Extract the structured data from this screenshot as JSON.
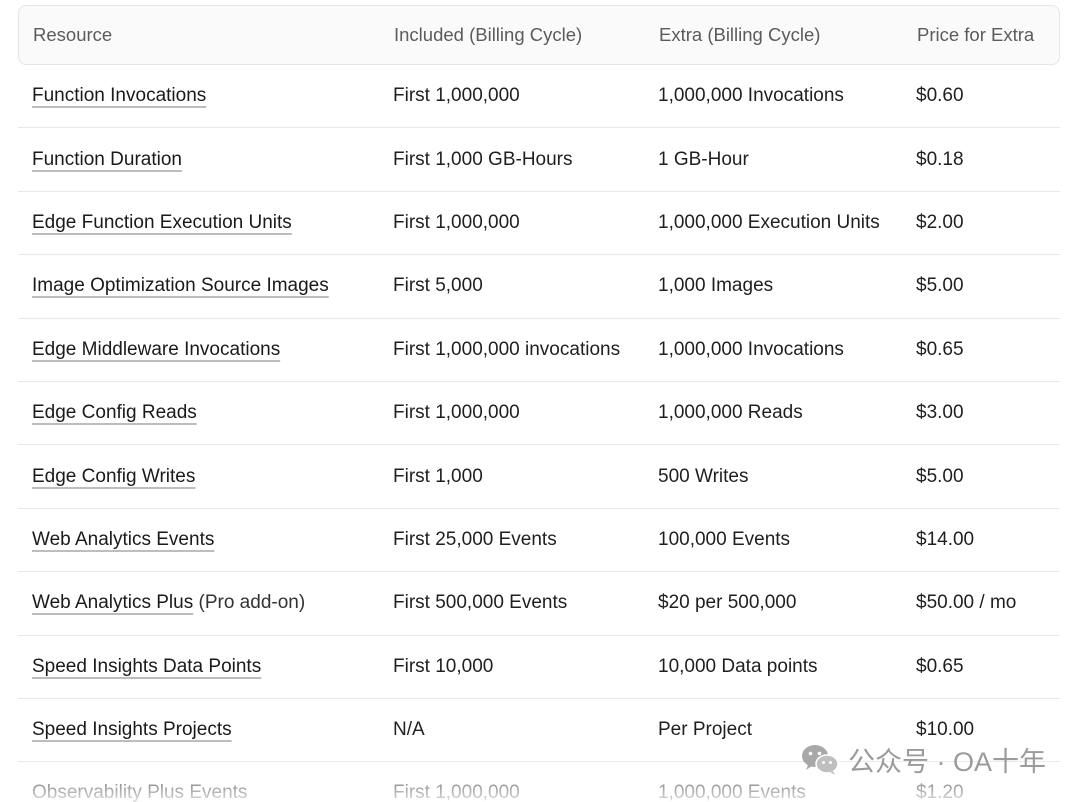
{
  "table": {
    "headers": [
      "Resource",
      "Included (Billing Cycle)",
      "Extra (Billing Cycle)",
      "Price for Extra"
    ],
    "rows": [
      {
        "resource": "Function Invocations",
        "suffix": "",
        "included": "First 1,000,000",
        "extra": "1,000,000 Invocations",
        "price": "$0.60"
      },
      {
        "resource": "Function Duration",
        "suffix": "",
        "included": "First 1,000 GB-Hours",
        "extra": "1 GB-Hour",
        "price": "$0.18"
      },
      {
        "resource": "Edge Function Execution Units",
        "suffix": "",
        "included": "First 1,000,000",
        "extra": "1,000,000 Execution Units",
        "price": "$2.00"
      },
      {
        "resource": "Image Optimization Source Images",
        "suffix": "",
        "included": "First 5,000",
        "extra": "1,000 Images",
        "price": "$5.00"
      },
      {
        "resource": "Edge Middleware Invocations",
        "suffix": "",
        "included": "First 1,000,000 invocations",
        "extra": "1,000,000 Invocations",
        "price": "$0.65"
      },
      {
        "resource": "Edge Config Reads",
        "suffix": "",
        "included": "First 1,000,000",
        "extra": "1,000,000 Reads",
        "price": "$3.00"
      },
      {
        "resource": "Edge Config Writes",
        "suffix": "",
        "included": "First 1,000",
        "extra": "500 Writes",
        "price": "$5.00"
      },
      {
        "resource": "Web Analytics Events",
        "suffix": "",
        "included": "First 25,000 Events",
        "extra": "100,000 Events",
        "price": "$14.00"
      },
      {
        "resource": "Web Analytics Plus",
        "suffix": " (Pro add-on)",
        "included": "First 500,000 Events",
        "extra": "$20 per 500,000",
        "price": "$50.00 / mo"
      },
      {
        "resource": "Speed Insights Data Points",
        "suffix": "",
        "included": "First 10,000",
        "extra": "10,000 Data points",
        "price": "$0.65"
      },
      {
        "resource": "Speed Insights Projects",
        "suffix": "",
        "included": "N/A",
        "extra": "Per Project",
        "price": "$10.00"
      },
      {
        "resource": "Observability Plus Events",
        "suffix": "",
        "included": "First 1,000,000",
        "extra": "1,000,000 Events",
        "price": "$1.20"
      }
    ]
  },
  "watermark": {
    "text": "公众号 · OA十年",
    "icon": "wechat-icon"
  }
}
